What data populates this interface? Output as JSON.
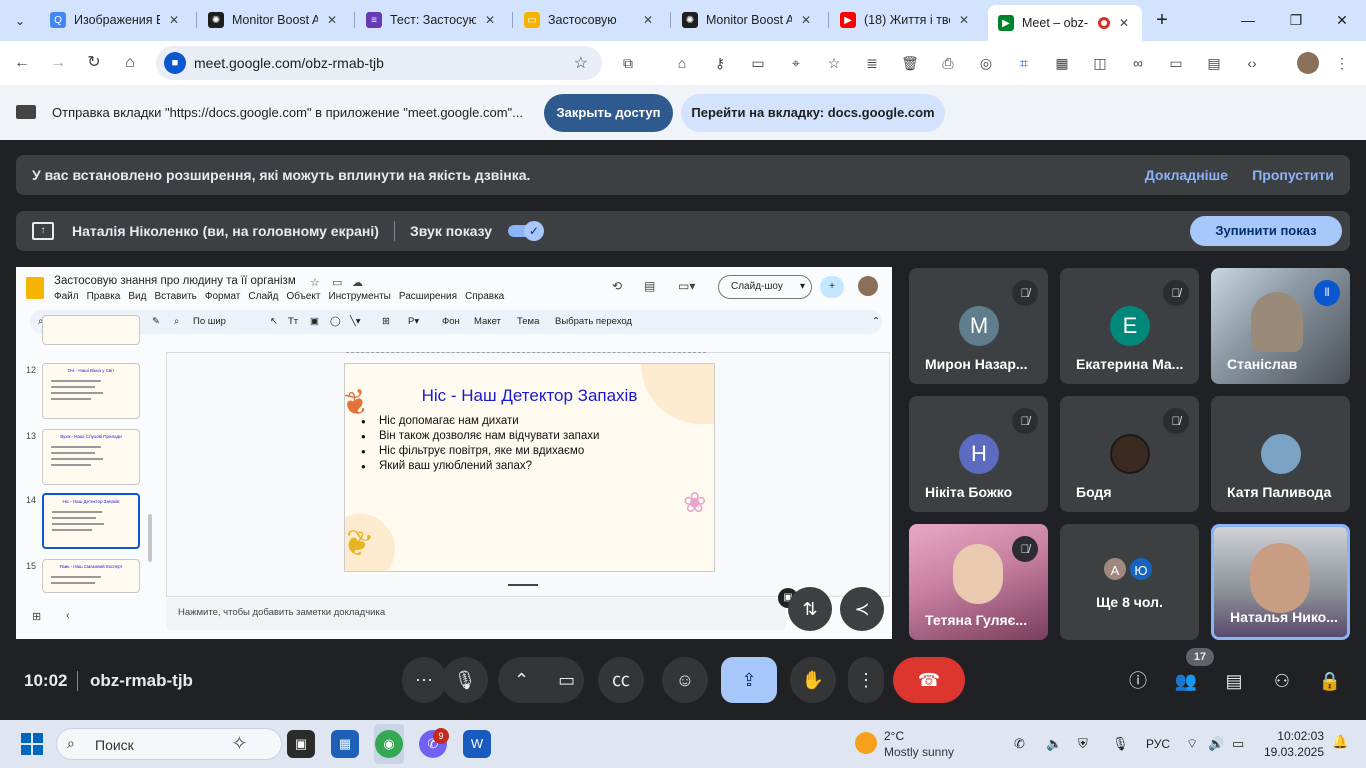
{
  "browser": {
    "tabs": [
      {
        "title": "Изображения В",
        "icon": "google-search-icon",
        "color": "#4285f4",
        "glyph": "Q"
      },
      {
        "title": "Monitor Boost A",
        "icon": "chatgpt-icon",
        "color": "#1f1f1f",
        "glyph": "✺"
      },
      {
        "title": "Тест: Застосую",
        "icon": "forms-icon",
        "color": "#673ab7",
        "glyph": "≡"
      },
      {
        "title": "Застосовую",
        "icon": "slides-icon",
        "color": "#f4b400",
        "glyph": "▭"
      },
      {
        "title": "Monitor Boost A",
        "icon": "chatgpt-icon",
        "color": "#1f1f1f",
        "glyph": "✺"
      },
      {
        "title": "(18) Життя і тво",
        "icon": "youtube-icon",
        "color": "#ff0000",
        "glyph": "▶"
      },
      {
        "title": "Meet – obz-",
        "icon": "meet-icon",
        "color": "#00832d",
        "glyph": "▶"
      }
    ],
    "url": "meet.google.com/obz-rmab-tjb"
  },
  "sharebar": {
    "text": "Отправка вкладки \"https://docs.google.com\" в приложение \"meet.google.com\"...",
    "stop_label": "Закрыть доступ",
    "goto_label": "Перейти на вкладку: docs.google.com"
  },
  "warning": {
    "text": "У вас встановлено розширення, які можуть вплинути на якість дзвінка.",
    "more": "Докладніше",
    "skip": "Пропустити"
  },
  "presenting": {
    "name": "Наталія Ніколенко (ви, на головному екрані)",
    "sound_label": "Звук показу",
    "sound_on": true,
    "stop_label": "Зупинити показ"
  },
  "slides": {
    "doc_title": "Застосовую знання про людину та її організм",
    "menu": [
      "Файл",
      "Правка",
      "Вид",
      "Вставить",
      "Формат",
      "Слайд",
      "Объект",
      "Инструменты",
      "Расширения",
      "Справка"
    ],
    "slideshow_label": "Слайд-шоу",
    "toolbar": {
      "zoom": "По шир",
      "bg": "Фон",
      "layout": "Макет",
      "theme": "Тема",
      "transition": "Выбрать переход"
    },
    "thumbnails": [
      {
        "num": "12",
        "title": "Очі - Наші Вікна у Світ"
      },
      {
        "num": "13",
        "title": "Вуха - Наші Слухові Прилади"
      },
      {
        "num": "14",
        "title": "Ніс - Наш Детектор Запахів"
      },
      {
        "num": "15",
        "title": "Язик - Наш Смаковий Експерт"
      }
    ],
    "current_slide": {
      "title": "Ніс - Наш Детектор Запахів",
      "bullets": [
        "Ніс допомагає нам дихати",
        "Він також дозволяє нам відчувати запахи",
        "Ніс фільтрує повітря, яке ми вдихаємо",
        "Який ваш улюблений запах?"
      ]
    },
    "notes_placeholder": "Нажмите, чтобы добавить заметки докладчика"
  },
  "participants": [
    {
      "name": "Мирон Назар...",
      "initial": "М",
      "color": "#5f7d8c",
      "muted": true,
      "video": false
    },
    {
      "name": "Екатерина Ма...",
      "initial": "Е",
      "color": "#00897b",
      "muted": true,
      "video": false
    },
    {
      "name": "Станіслав",
      "initial": "",
      "color": "#8d9aa6",
      "muted": false,
      "video": true
    },
    {
      "name": "Нікіта Божко",
      "initial": "Н",
      "color": "#5c6bc0",
      "muted": true,
      "video": false
    },
    {
      "name": "Бодя",
      "initial": "",
      "color": "#3b2a20",
      "muted": true,
      "video": false
    },
    {
      "name": "Катя Паливода",
      "initial": "",
      "color": "#7aa3c6",
      "muted": false,
      "video": false
    },
    {
      "name": "Тетяна Гуляє...",
      "initial": "",
      "color": "#c77fa0",
      "muted": true,
      "video": true
    },
    {
      "name": "Ще 8 чол.",
      "initials": [
        "А",
        "Ю"
      ],
      "colors": [
        "#a1887f",
        "#1565c0"
      ]
    },
    {
      "name": "Наталья Нико...",
      "initial": "",
      "color": "#7a7f86",
      "muted": false,
      "video": true,
      "self": true
    }
  ],
  "meeting": {
    "time": "10:02",
    "code": "obz-rmab-tjb",
    "participant_count": "17"
  },
  "taskbar": {
    "search_placeholder": "Поиск",
    "weather_temp": "2°C",
    "weather_desc": "Mostly sunny",
    "lang": "РУС",
    "time": "10:02:03",
    "date": "19.03.2025",
    "viber_badge": "9"
  }
}
